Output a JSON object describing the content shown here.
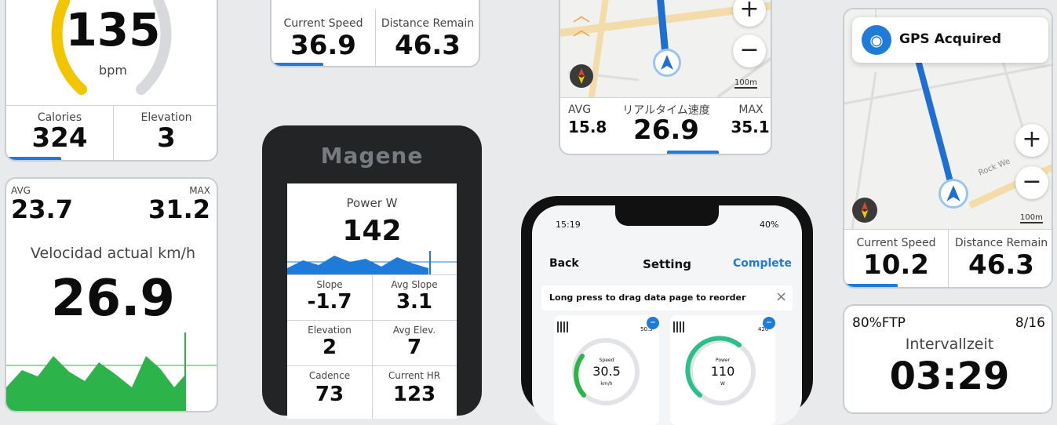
{
  "heart_card": {
    "value": "135",
    "unit": "bpm",
    "calories_label": "Calories",
    "calories_value": "324",
    "elevation_label": "Elevation",
    "elevation_value": "3"
  },
  "speed_top_card": {
    "current_speed_label": "Current Speed",
    "current_speed_value": "36.9",
    "distance_label": "Distance Remain",
    "distance_value": "46.3"
  },
  "map_top_card": {
    "zoom_in": "+",
    "zoom_out": "−",
    "scale": "100m",
    "avg_label": "AVG",
    "avg_value": "15.8",
    "speed_label": "リアルタイム速度",
    "speed_value": "26.9",
    "max_label": "MAX",
    "max_value": "35.1"
  },
  "gps_card": {
    "toast": "GPS Acquired",
    "zoom_in": "+",
    "zoom_out": "−",
    "scale": "100m",
    "road_label": "Rock We",
    "current_speed_label": "Current Speed",
    "current_speed_value": "10.2",
    "distance_label": "Distance Remain",
    "distance_value": "46.3"
  },
  "velocity_card": {
    "avg_label": "AVG",
    "avg_value": "23.7",
    "max_label": "MAX",
    "max_value": "31.2",
    "title": "Velocidad actual km/h",
    "value": "26.9"
  },
  "device": {
    "brand": "Magene",
    "power_label": "Power W",
    "power_value": "142",
    "cells": [
      {
        "label": "Slope",
        "value": "-1.7"
      },
      {
        "label": "Avg Slope",
        "value": "3.1"
      },
      {
        "label": "Elevation",
        "value": "2"
      },
      {
        "label": "Avg Elev.",
        "value": "7"
      },
      {
        "label": "Cadence",
        "value": "73"
      },
      {
        "label": "Current HR",
        "value": "123"
      }
    ]
  },
  "phone": {
    "time": "15:19",
    "battery": "40%",
    "back": "Back",
    "title": "Setting",
    "complete": "Complete",
    "hint": "Long press to drag data page to reorder",
    "close": "×",
    "widget1": {
      "label": "Speed",
      "value": "30.5",
      "unit": "km/h",
      "corner": "50.5"
    },
    "widget2": {
      "label": "Power",
      "value": "110",
      "unit": "W",
      "corner": "420"
    }
  },
  "interval_card": {
    "label": "80%FTP",
    "count": "8/16",
    "title": "Intervallzeit",
    "value": "03:29"
  },
  "colors": {
    "accent_blue": "#1f7bd8",
    "green": "#2cb34a",
    "yellow": "#f2c500",
    "device_body": "#222426"
  }
}
